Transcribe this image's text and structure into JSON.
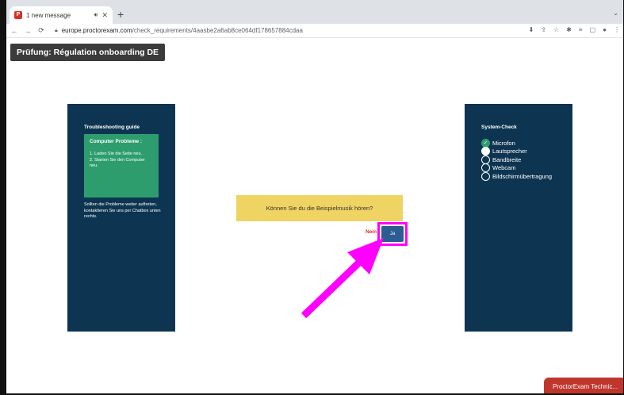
{
  "browser": {
    "tab_title": "1 new message",
    "tab_favicon": "proctorexam-favicon",
    "new_tab_label": "+",
    "url_host": "europe.proctorexam.com",
    "url_path": "/check_requirements/4aasbe2a6ab8ce064df178657884cdaa"
  },
  "page": {
    "exam_title": "Prüfung: Régulation onboarding DE"
  },
  "troubleshooting": {
    "title": "Troubleshooting guide",
    "box_heading": "Computer Probleme :",
    "steps": [
      "1. Laden Sie die Seite neu.",
      "2. Starten Sie den Computer neu."
    ],
    "note": "Sollten die Probleme weiter auftreten, kontaktieren Sie uns per Chatbox unten rechts."
  },
  "system_check": {
    "title": "System-Check",
    "items": [
      {
        "label": "Microfon",
        "state": "done"
      },
      {
        "label": "Lautsprecher",
        "state": "active"
      },
      {
        "label": "Bandbreite",
        "state": "pending"
      },
      {
        "label": "Webcam",
        "state": "pending"
      },
      {
        "label": "Bildschirmübertragung",
        "state": "pending"
      }
    ]
  },
  "question": {
    "text": "Können Sie du die Beispielmusik hören?",
    "no_label": "Nein",
    "yes_label": "Ja"
  },
  "chat": {
    "label": "ProctorExam Technic..."
  },
  "colors": {
    "panel": "#0d3551",
    "success": "#2e9d6e",
    "question_bg": "#f0d463",
    "yes_button": "#2b5c92",
    "highlight": "#ff00ff",
    "chat": "#c0362c"
  }
}
